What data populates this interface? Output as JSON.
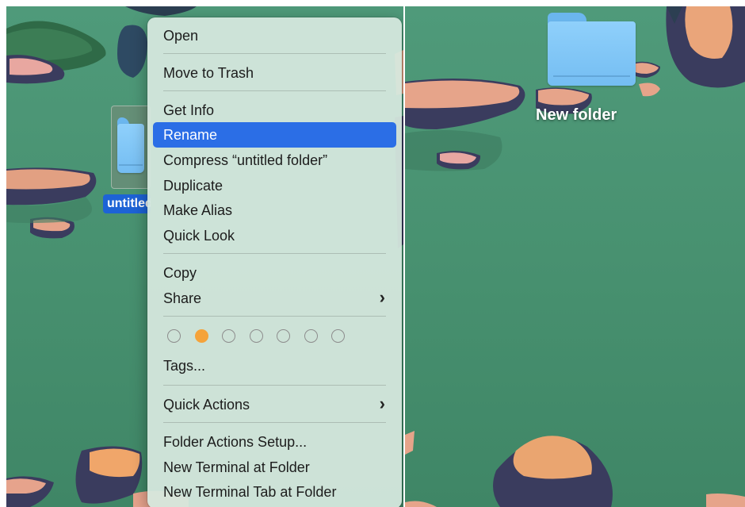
{
  "context_menu": {
    "open": "Open",
    "move_to_trash": "Move to Trash",
    "get_info": "Get Info",
    "rename": "Rename",
    "compress": "Compress “untitled folder”",
    "duplicate": "Duplicate",
    "make_alias": "Make Alias",
    "quick_look": "Quick Look",
    "copy": "Copy",
    "share": "Share",
    "tags": "Tags...",
    "quick_actions": "Quick Actions",
    "folder_actions_setup": "Folder Actions Setup...",
    "new_terminal": "New Terminal at Folder",
    "new_terminal_tab": "New Terminal Tab at Folder",
    "submenu_chevron": "›",
    "tag_colors": [
      "none",
      "#f5a33a",
      "none",
      "none",
      "none",
      "none",
      "none"
    ]
  },
  "desktop_left": {
    "selected_folder_label": "untitled folder",
    "selection_color": "#1d63d6"
  },
  "desktop_right": {
    "folder_label": "New folder"
  },
  "colors": {
    "wallpaper_green": "#4a9473",
    "rock_peach": "#eaa583",
    "rock_shadow": "#3c3d5c",
    "highlight_blue": "#2b6ee6",
    "folder_blue": "#7fc6f6"
  }
}
